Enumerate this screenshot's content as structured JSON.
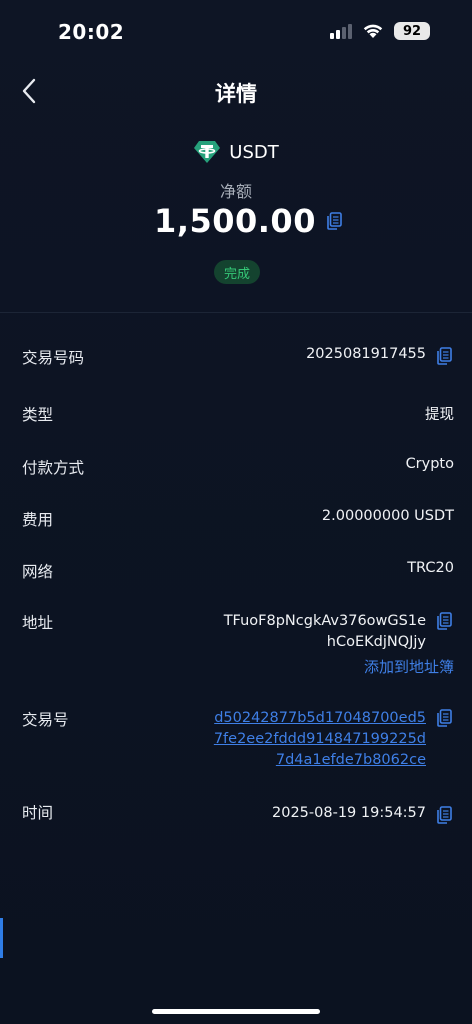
{
  "status_bar": {
    "time": "20:02",
    "battery": "92"
  },
  "nav": {
    "title": "详情"
  },
  "summary": {
    "currency": "USDT",
    "net_label": "净额",
    "amount": "1,500.00",
    "status": "完成"
  },
  "details": {
    "order_no": {
      "label": "交易号码",
      "value": "2025081917455"
    },
    "type": {
      "label": "类型",
      "value": "提现"
    },
    "payment_method": {
      "label": "付款方式",
      "value": "Crypto"
    },
    "fee": {
      "label": "费用",
      "value": "2.00000000 USDT"
    },
    "network": {
      "label": "网络",
      "value": "TRC20"
    },
    "address": {
      "label": "地址",
      "line1": "TFuoF8pNcgkAv376owGS1e",
      "line2": "hCoEKdjNQJjy",
      "add_link": "添加到地址簿"
    },
    "txid": {
      "label": "交易号",
      "line1": "d50242877b5d17048700ed5",
      "line2": "7fe2ee2fddd914847199225d",
      "line3": "7d4a1efde7b8062ce"
    },
    "time": {
      "label": "时间",
      "value": "2025-08-19 19:54:57"
    }
  },
  "colors": {
    "background": "#0d1422",
    "accent_blue": "#3f7fe6",
    "success_green": "#35c777",
    "success_bg": "#14432f",
    "tether_teal": "#26a17b"
  },
  "icons": {
    "back": "chevron-left-icon",
    "copy": "copy-icon",
    "currency": "tether-icon",
    "wifi": "wifi-icon",
    "signal": "cellular-signal-icon",
    "battery": "battery-icon"
  }
}
